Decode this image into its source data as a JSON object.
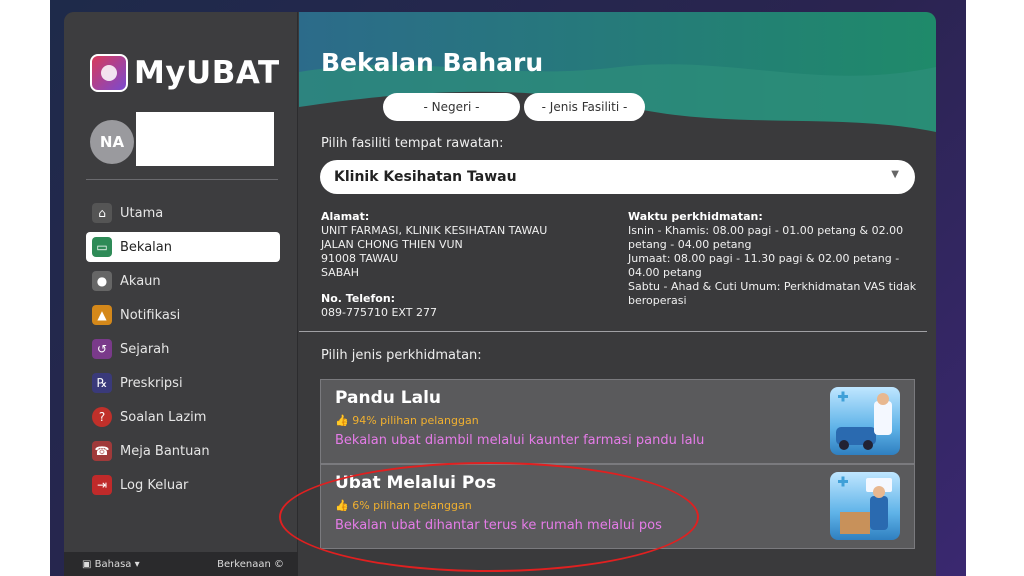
{
  "app": {
    "name": "MyUBAT"
  },
  "user": {
    "initials": "NA"
  },
  "sidebar": {
    "items": [
      {
        "label": "Utama",
        "icon": "home-icon",
        "active": false
      },
      {
        "label": "Bekalan",
        "icon": "inbox-icon",
        "active": true
      },
      {
        "label": "Akaun",
        "icon": "user-icon",
        "active": false
      },
      {
        "label": "Notifikasi",
        "icon": "bell-icon",
        "active": false
      },
      {
        "label": "Sejarah",
        "icon": "history-icon",
        "active": false
      },
      {
        "label": "Preskripsi",
        "icon": "prescription-icon",
        "active": false
      },
      {
        "label": "Soalan Lazim",
        "icon": "question-icon",
        "active": false
      },
      {
        "label": "Meja Bantuan",
        "icon": "helpdesk-icon",
        "active": false
      },
      {
        "label": "Log Keluar",
        "icon": "logout-icon",
        "active": false
      }
    ],
    "language_label": "Bahasa",
    "about_label": "Berkenaan"
  },
  "main": {
    "title": "Bekalan Baharu",
    "filter_state": "- Negeri -",
    "filter_facility_type": "- Jenis Fasiliti -",
    "facility_prompt": "Pilih fasiliti tempat rawatan:",
    "facility_selected": "Klinik Kesihatan Tawau",
    "address_label": "Alamat:",
    "address_lines": [
      "UNIT FARMASI, KLINIK KESIHATAN TAWAU",
      "JALAN CHONG THIEN VUN",
      "91008 TAWAU",
      "SABAH"
    ],
    "phone_label": "No. Telefon:",
    "phone": "089-775710 EXT 277",
    "hours_label": "Waktu perkhidmatan:",
    "hours_lines": [
      "Isnin - Khamis: 08.00 pagi - 01.00 petang & 02.00",
      "petang - 04.00 petang",
      "Jumaat: 08.00 pagi - 11.30 pagi & 02.00 petang -",
      "04.00 petang",
      "Sabtu - Ahad & Cuti Umum: Perkhidmatan VAS tidak",
      "beroperasi"
    ],
    "service_prompt": "Pilih jenis perkhidmatan:",
    "services": [
      {
        "title": "Pandu Lalu",
        "popularity": "94% pilihan pelanggan",
        "description": "Bekalan ubat diambil melalui kaunter farmasi pandu lalu",
        "image": "drive-through-pharmacy-image"
      },
      {
        "title": "Ubat Melalui Pos",
        "popularity": "6% pilihan pelanggan",
        "description": "Bekalan ubat dihantar terus ke rumah melalui pos",
        "image": "postal-delivery-image"
      }
    ]
  },
  "colors": {
    "accent_pink": "#e57ce8",
    "accent_gold": "#f0b030",
    "highlight_red": "#e02020"
  }
}
